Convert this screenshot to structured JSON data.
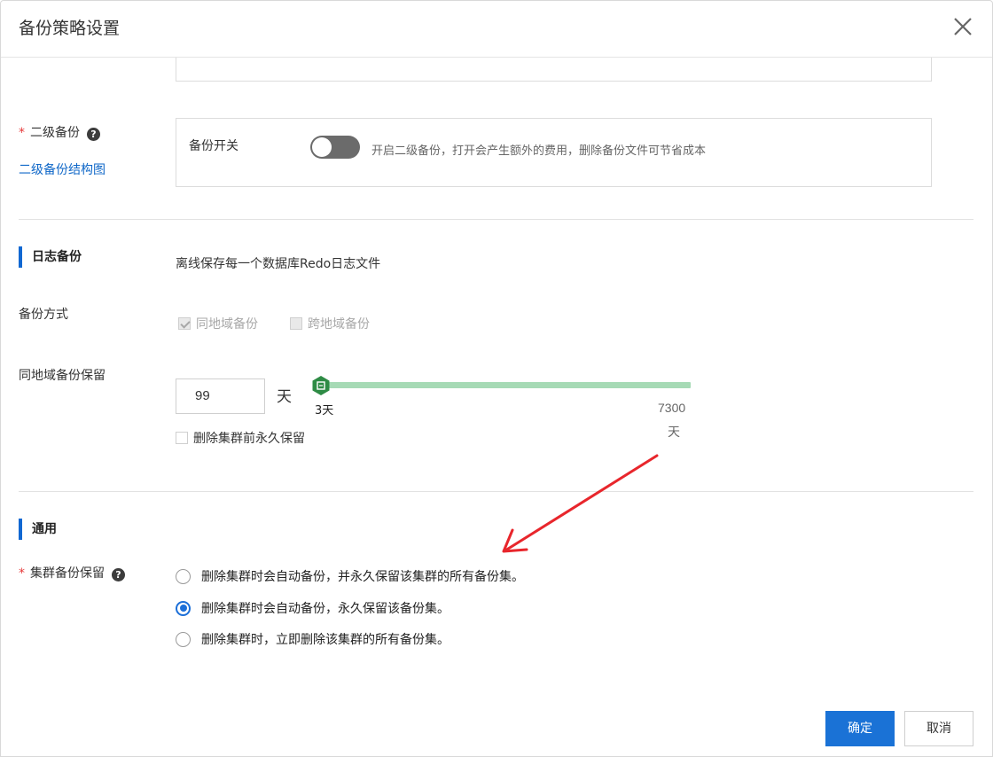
{
  "dialog": {
    "title": "备份策略设置"
  },
  "secondary_backup": {
    "label": "二级备份",
    "help_icon": "?",
    "link": "二级备份结构图",
    "switch_label": "备份开关",
    "switch_on": false,
    "description": "开启二级备份，打开会产生额外的费用，删除备份文件可节省成本"
  },
  "log_backup": {
    "title": "日志备份",
    "description": "离线保存每一个数据库Redo日志文件",
    "method_label": "备份方式",
    "methods": [
      {
        "label": "同地域备份",
        "checked": true,
        "disabled": true
      },
      {
        "label": "跨地域备份",
        "checked": false,
        "disabled": true
      }
    ],
    "retention_label": "同地域备份保留",
    "retention_value": "99",
    "retention_unit": "天",
    "slider": {
      "min_label": "3天",
      "max_label": "7300",
      "max_unit": "天",
      "color": "#a6dab5",
      "handle_color": "#2e8b45"
    },
    "keep_forever_label": "删除集群前永久保留"
  },
  "general": {
    "title": "通用",
    "cluster_retention_label": "集群备份保留",
    "help_icon": "?",
    "options": [
      {
        "label": "删除集群时会自动备份，并永久保留该集群的所有备份集。",
        "selected": false
      },
      {
        "label": "删除集群时会自动备份，永久保留该备份集。",
        "selected": true
      },
      {
        "label": "删除集群时，立即删除该集群的所有备份集。",
        "selected": false
      }
    ]
  },
  "footer": {
    "confirm": "确定",
    "cancel": "取消"
  },
  "colors": {
    "primary": "#1a72d6",
    "link": "#0f67c8",
    "required": "#e6393a",
    "annotation_arrow": "#e8262c"
  }
}
